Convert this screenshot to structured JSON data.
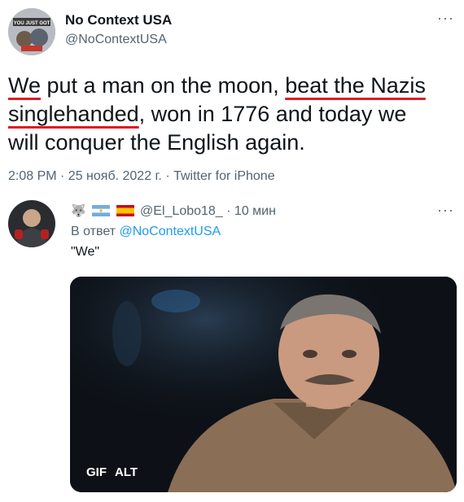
{
  "tweet": {
    "author_name": "No Context USA",
    "author_handle": "@NoContextUSA",
    "avatar_caption": "YOU JUST GOT",
    "text_parts": {
      "p1": "We",
      "p2": " put a man on the moon, ",
      "p3": "beat the Nazis",
      "p4": "singlehanded",
      "p5": ", won in 1776 and today we",
      "p6": "will conquer the English again."
    },
    "timestamp": "2:08 PM · 25 нояб. 2022 г. · Twitter for iPhone"
  },
  "reply": {
    "handle": "@El_Lobo18_",
    "time": "· 10 мин",
    "reply_prefix": "В ответ",
    "reply_to": "@NoContextUSA",
    "text": "\"We\"",
    "media_badges": {
      "gif": "GIF",
      "alt": "ALT"
    }
  },
  "ui": {
    "more_label": "···"
  },
  "colors": {
    "underline": "#e01b24",
    "link": "#1d9bf0",
    "secondary_text": "#536471"
  }
}
